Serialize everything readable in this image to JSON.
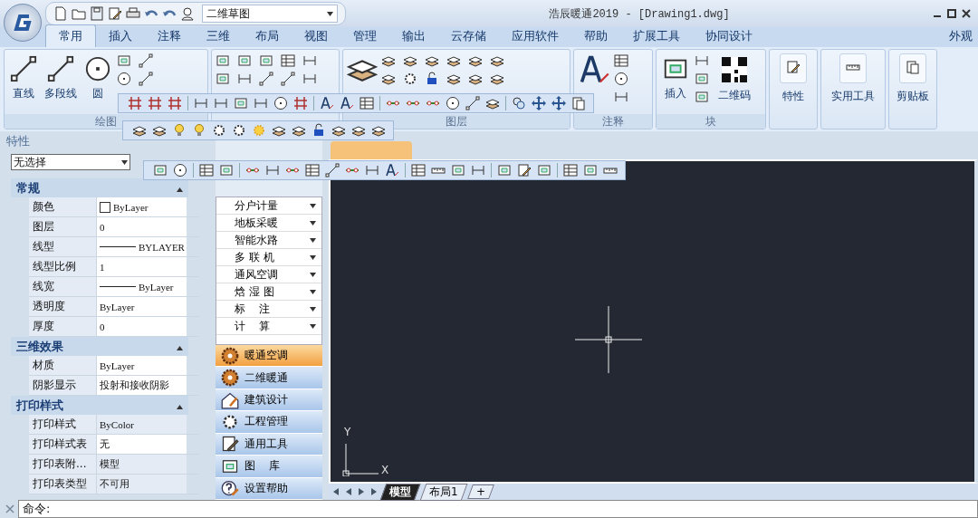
{
  "app": {
    "workspace": "二维草图",
    "title": "浩辰暖通2019 - [Drawing1.dwg]"
  },
  "tabs": [
    {
      "label": "常用",
      "selected": true
    },
    {
      "label": "插入",
      "selected": false
    },
    {
      "label": "注释",
      "selected": false
    },
    {
      "label": "三维",
      "selected": false
    },
    {
      "label": "布局",
      "selected": false
    },
    {
      "label": "视图",
      "selected": false
    },
    {
      "label": "管理",
      "selected": false
    },
    {
      "label": "输出",
      "selected": false
    },
    {
      "label": "云存储",
      "selected": false
    },
    {
      "label": "应用软件",
      "selected": false
    },
    {
      "label": "帮助",
      "selected": false
    },
    {
      "label": "扩展工具",
      "selected": false
    },
    {
      "label": "协同设计",
      "selected": false
    }
  ],
  "appearance_menu": "外观",
  "ribbon": {
    "draw": {
      "label": "绘图",
      "buttons": [
        "直线",
        "多段线",
        "圆"
      ]
    },
    "layers": {
      "label": "图层"
    },
    "annotation": {
      "label": "注释"
    },
    "block": {
      "label": "块",
      "buttons": [
        "插入",
        "二维码"
      ]
    },
    "panels": [
      "特性",
      "实用工具",
      "剪贴板"
    ]
  },
  "properties": {
    "title": "特性",
    "selection": "无选择",
    "sections": [
      {
        "title": "常规",
        "expanded": true,
        "rows": [
          {
            "name": "颜色",
            "value": "ByLayer",
            "kind": "swatch",
            "disabled": false
          },
          {
            "name": "图层",
            "value": "0",
            "kind": "plain",
            "disabled": false
          },
          {
            "name": "线型",
            "value": "BYLAYER",
            "kind": "line",
            "disabled": false
          },
          {
            "name": "线型比例",
            "value": "1",
            "kind": "plain",
            "disabled": false
          },
          {
            "name": "线宽",
            "value": "ByLayer",
            "kind": "line",
            "disabled": false
          },
          {
            "name": "透明度",
            "value": "ByLayer",
            "kind": "plain",
            "disabled": false
          },
          {
            "name": "厚度",
            "value": "0",
            "kind": "plain",
            "disabled": false
          }
        ]
      },
      {
        "title": "三维效果",
        "expanded": true,
        "rows": [
          {
            "name": "材质",
            "value": "ByLayer",
            "kind": "plain",
            "disabled": false
          },
          {
            "name": "阴影显示",
            "value": "投射和接收阴影",
            "kind": "plain",
            "disabled": false
          }
        ]
      },
      {
        "title": "打印样式",
        "expanded": true,
        "rows": [
          {
            "name": "打印样式",
            "value": "ByColor",
            "kind": "plain",
            "disabled": true
          },
          {
            "name": "打印样式表",
            "value": "无",
            "kind": "plain",
            "disabled": false
          },
          {
            "name": "打印表附...",
            "value": "模型",
            "kind": "plain",
            "disabled": true
          },
          {
            "name": "打印表类型",
            "value": "不可用",
            "kind": "plain",
            "disabled": true
          }
        ]
      }
    ]
  },
  "palette": {
    "items": [
      "分户计量",
      "地板采暖",
      "智能水路",
      "多 联 机",
      "通风空调",
      "焓 湿 图",
      "标    注",
      "计    算"
    ],
    "categories": [
      {
        "label": "暖通空调",
        "selected": true
      },
      {
        "label": "二维暖通",
        "selected": false
      },
      {
        "label": "建筑设计",
        "selected": false
      },
      {
        "label": "工程管理",
        "selected": false
      },
      {
        "label": "通用工具",
        "selected": false
      },
      {
        "label": "图    库",
        "selected": false
      },
      {
        "label": "设置帮助",
        "selected": false
      }
    ]
  },
  "axis_labels": {
    "x": "X",
    "y": "Y"
  },
  "layout_tabs": [
    {
      "label": "模型",
      "selected": true
    },
    {
      "label": "布局1",
      "selected": false
    },
    {
      "label": "+",
      "selected": false
    }
  ],
  "command": {
    "prompt": "命令:"
  }
}
